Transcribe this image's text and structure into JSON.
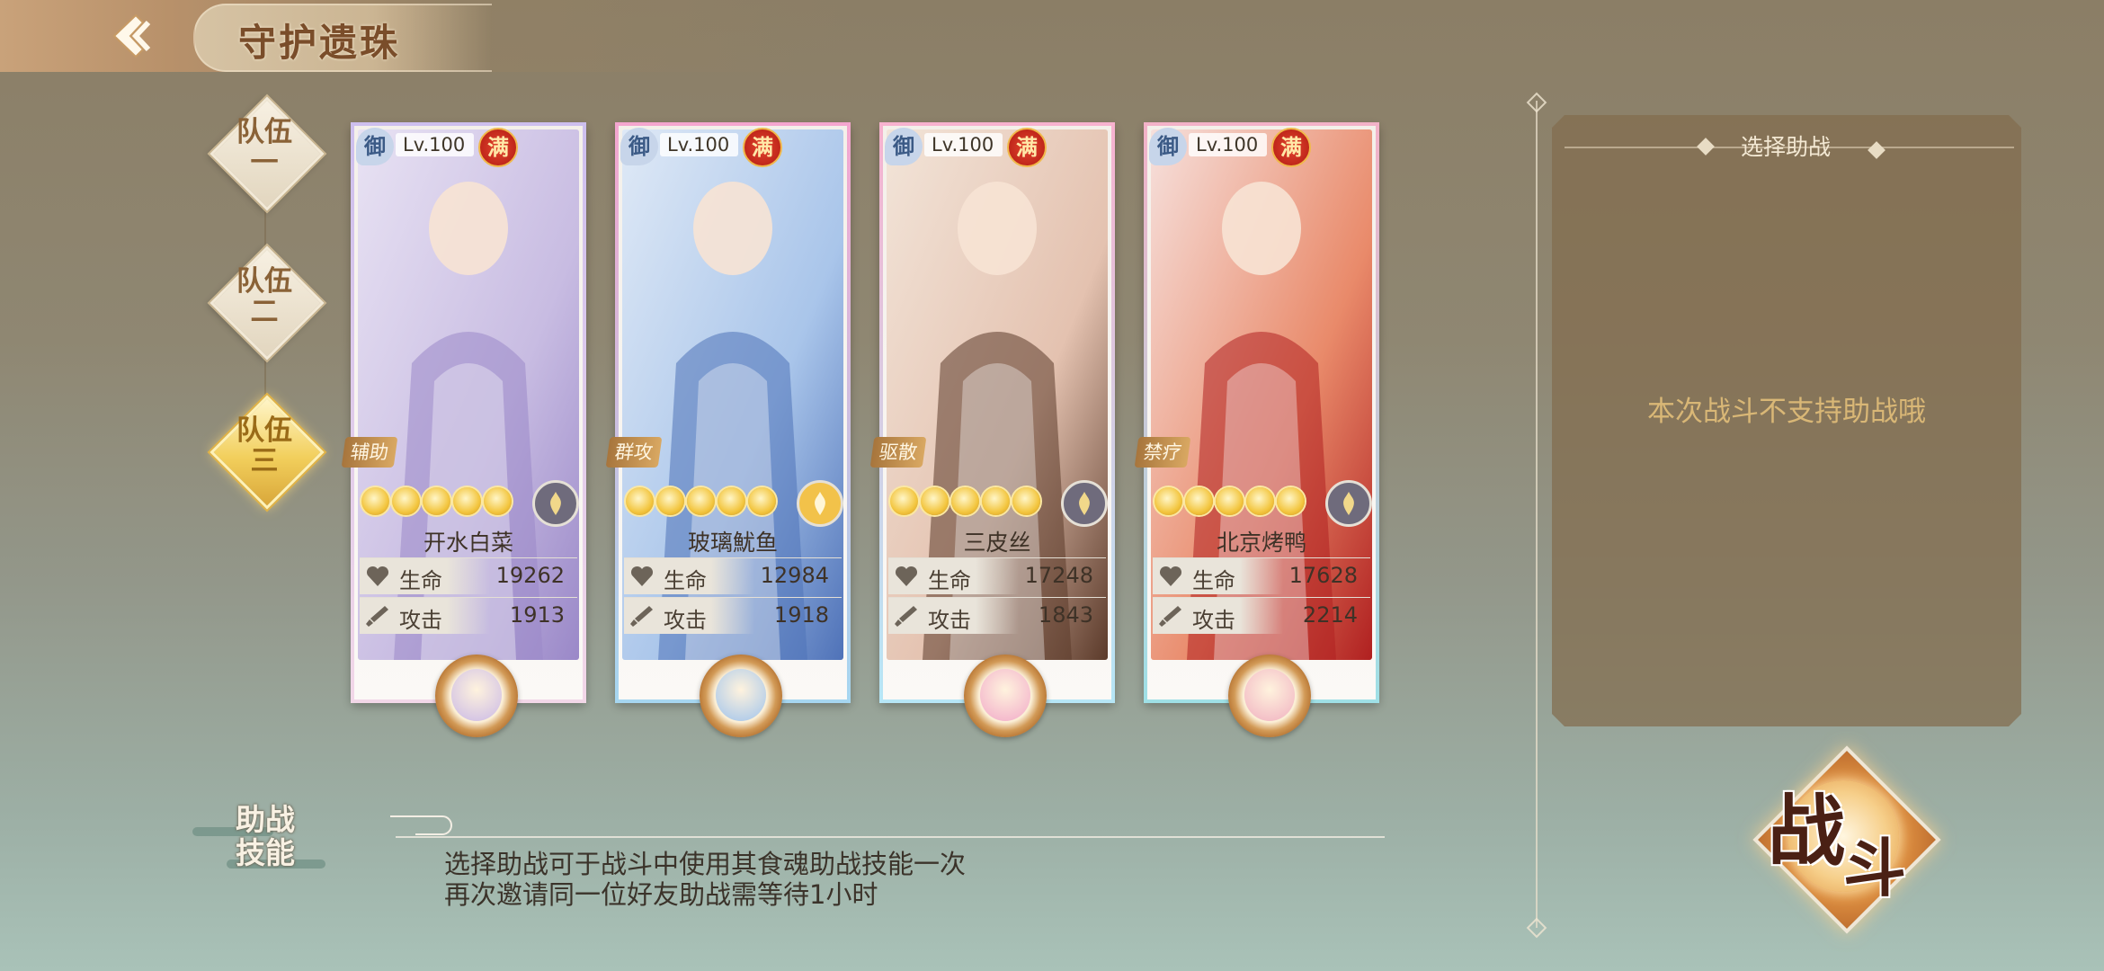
{
  "header": {
    "title": "守护遗珠",
    "back_icon": "back-arrow-icon"
  },
  "teams": [
    {
      "label_top": "队伍",
      "label_bottom": "一",
      "selected": false
    },
    {
      "label_top": "队伍",
      "label_bottom": "二",
      "selected": false
    },
    {
      "label_top": "队伍",
      "label_bottom": "三",
      "selected": true
    }
  ],
  "cards": [
    {
      "badge": "御",
      "level": "Lv.100",
      "max_badge": "满",
      "role": "辅助",
      "stars": 5,
      "element_icon": "flower-dark-icon",
      "name": "开水白菜",
      "hp_label": "生命",
      "hp": "19262",
      "atk_label": "攻击",
      "atk": "1913",
      "accent": "#c9b8e6"
    },
    {
      "badge": "御",
      "level": "Lv.100",
      "max_badge": "满",
      "role": "群攻",
      "stars": 5,
      "element_icon": "flower-gold-icon",
      "name": "玻璃魷鱼",
      "hp_label": "生命",
      "hp": "12984",
      "atk_label": "攻击",
      "atk": "1918",
      "accent": "#9fc3ec"
    },
    {
      "badge": "御",
      "level": "Lv.100",
      "max_badge": "满",
      "role": "驱散",
      "stars": 5,
      "element_icon": "flame-dark-icon",
      "name": "三皮丝",
      "hp_label": "生命",
      "hp": "17248",
      "atk_label": "攻击",
      "atk": "1843",
      "accent": "#f1a9c8"
    },
    {
      "badge": "御",
      "level": "Lv.100",
      "max_badge": "满",
      "role": "禁疗",
      "stars": 5,
      "element_icon": "flame-dark-icon",
      "name": "北京烤鸭",
      "hp_label": "生命",
      "hp": "17628",
      "atk_label": "攻击",
      "atk": "2214",
      "accent": "#f0b0c0"
    }
  ],
  "assist_panel": {
    "title": "选择助战",
    "message": "本次战斗不支持助战哦"
  },
  "assist_skill": {
    "badge_line1": "助战",
    "badge_line2": "技能",
    "desc_line1": "选择助战可于战斗中使用其食魂助战技能一次",
    "desc_line2": "再次邀请同一位好友助战需等待1小时"
  },
  "fight_button": {
    "char1": "战",
    "char2": "斗"
  }
}
